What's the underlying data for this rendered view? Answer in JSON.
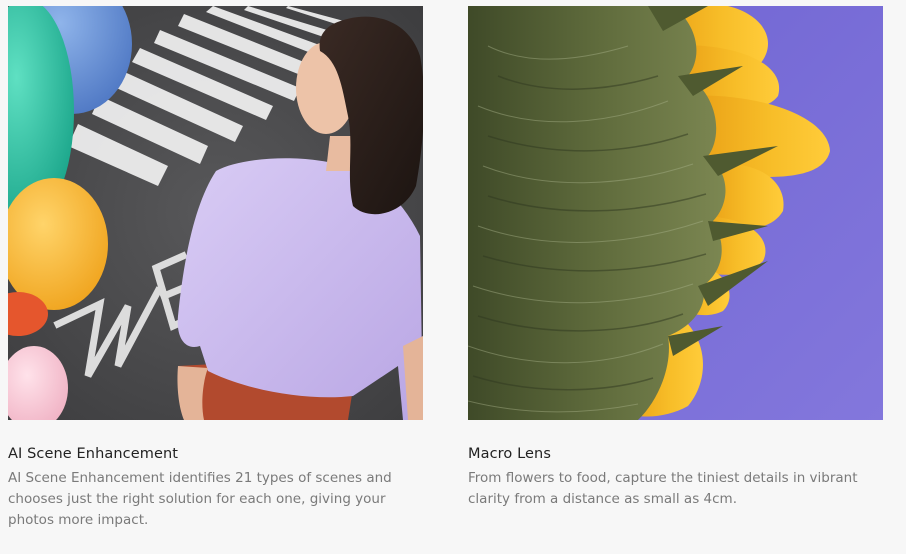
{
  "cards": [
    {
      "title": "AI Scene Enhancement",
      "description": "AI Scene Enhancement identifies 21 types of scenes and chooses just the right solution for each one, giving your photos more impact.",
      "image_subject": "woman-with-balloons-on-crosswalk",
      "street_text": "WE"
    },
    {
      "title": "Macro Lens",
      "description": "From flowers to food, capture the tiniest details in vibrant clarity from a distance as small as 4cm.",
      "image_subject": "sunflower-closeup"
    }
  ],
  "colors": {
    "background": "#f7f7f7",
    "title": "#222222",
    "description": "#7a7a7a",
    "asphalt": "#4a4a4c",
    "shirt": "#c9b8ec",
    "sky_purple": "#7b6fd6",
    "petal_yellow": "#f5b51e",
    "sepal_green": "#5f6b3c"
  }
}
